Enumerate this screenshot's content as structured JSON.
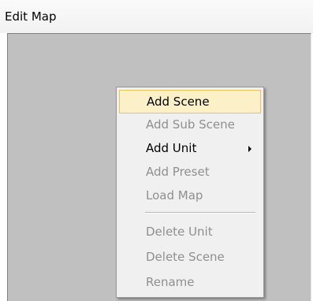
{
  "window": {
    "title": "Edit Map"
  },
  "context_menu": {
    "items": [
      {
        "label": "Add Scene",
        "enabled": true,
        "highlighted": true
      },
      {
        "label": "Add Sub Scene",
        "enabled": false
      },
      {
        "label": "Add Unit",
        "enabled": true,
        "submenu": true
      },
      {
        "label": "Add Preset",
        "enabled": false
      },
      {
        "label": "Load Map",
        "enabled": false
      },
      {
        "label": "Delete Unit",
        "enabled": false
      },
      {
        "label": "Delete Scene",
        "enabled": false
      },
      {
        "label": "Rename",
        "enabled": false
      }
    ]
  },
  "colors": {
    "canvas": "#c0c0c0",
    "menu_bg": "#f0f0f0",
    "highlight_bg": "#fcf0c8",
    "highlight_border": "#e5c365",
    "disabled_text": "#8f8f8f"
  }
}
